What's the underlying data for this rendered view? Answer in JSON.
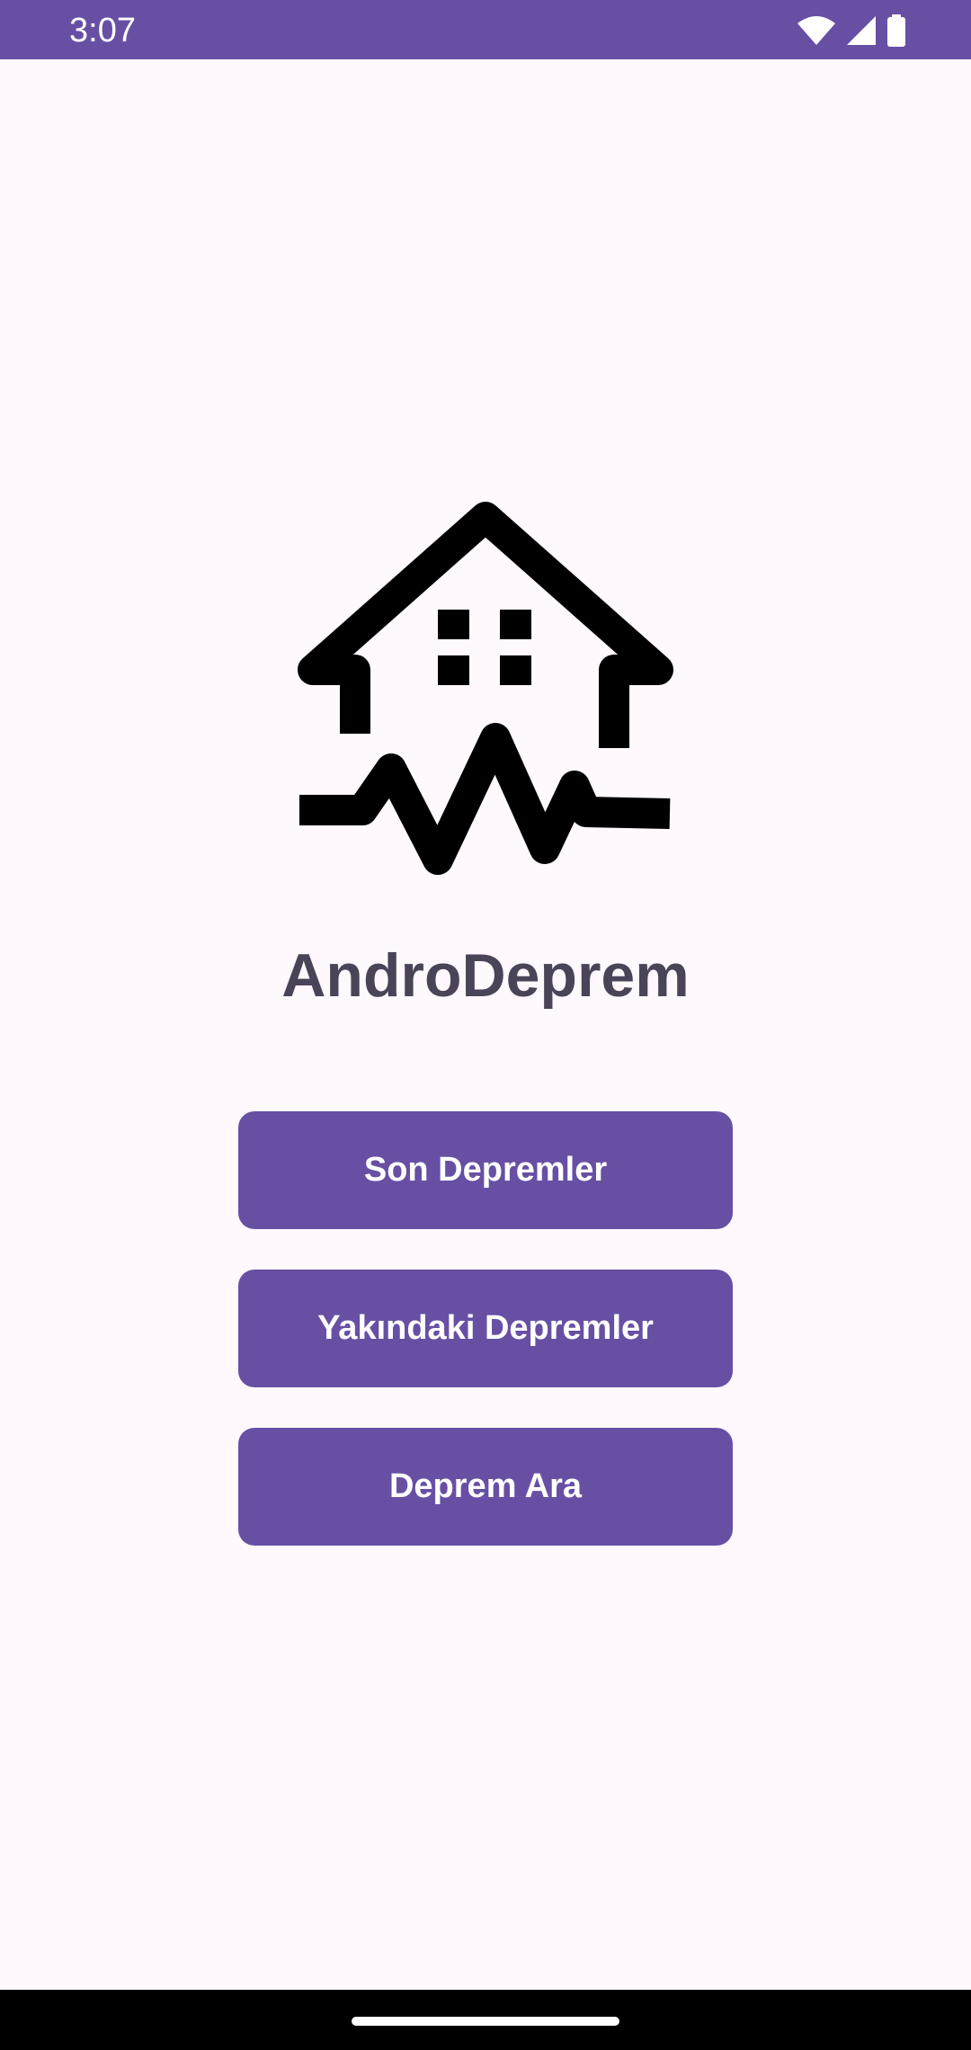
{
  "status_bar": {
    "time": "3:07",
    "background": "#6750A4",
    "icons": [
      "wifi-icon",
      "cellular-signal-icon",
      "battery-icon"
    ]
  },
  "app": {
    "logo": "house-seismograph-icon",
    "title": "AndroDeprem"
  },
  "buttons": [
    {
      "label": "Son Depremler"
    },
    {
      "label": "Yakındaki Depremler"
    },
    {
      "label": "Deprem Ara"
    }
  ],
  "colors": {
    "primary": "#6750A4",
    "background": "#FFF8FD",
    "title_text": "#4A4458",
    "on_primary": "#FFFFFF"
  }
}
